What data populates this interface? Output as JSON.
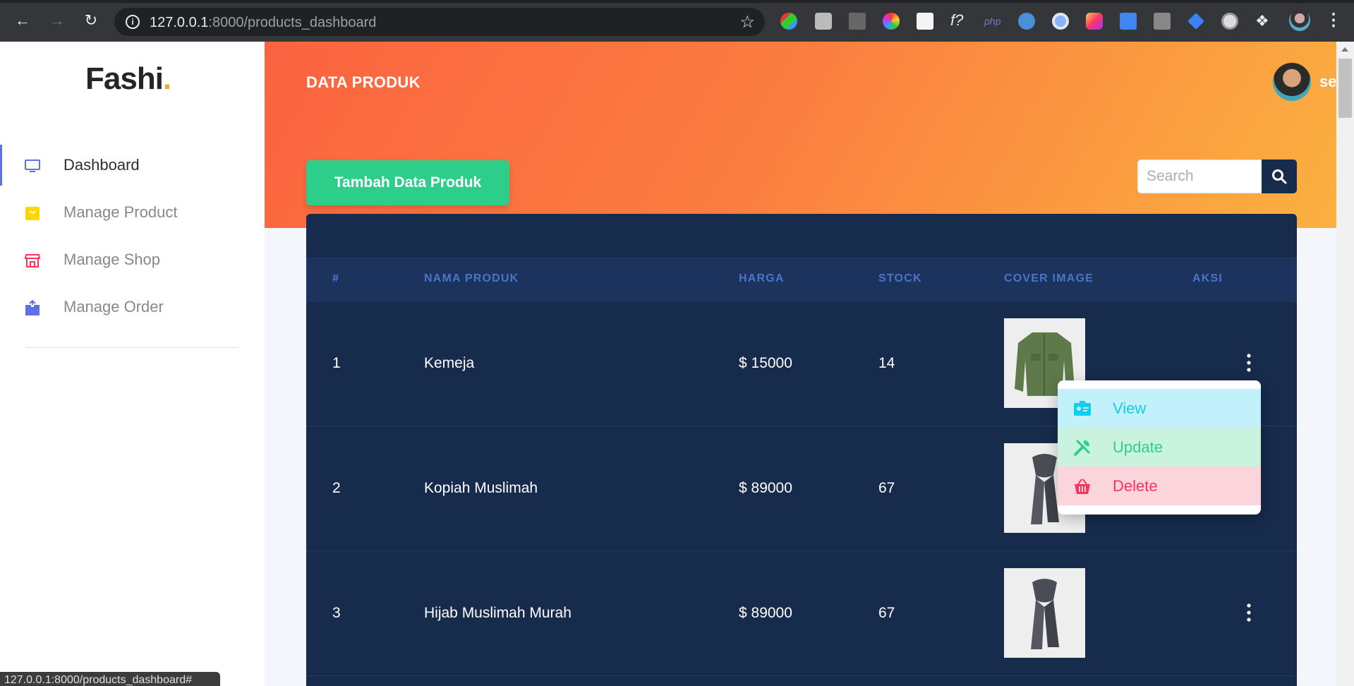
{
  "browser": {
    "url_host": "127.0.0.1",
    "url_path": ":8000/products_dashboard",
    "status_url": "127.0.0.1:8000/products_dashboard#"
  },
  "brand": {
    "name": "Fashi",
    "dot": "."
  },
  "sidebar": {
    "items": [
      {
        "label": "Dashboard",
        "icon": "monitor-icon",
        "color": "#5e72e4",
        "active": true
      },
      {
        "label": "Manage Product",
        "icon": "shopping-bag-icon",
        "color": "#ffd600",
        "active": false
      },
      {
        "label": "Manage Shop",
        "icon": "shop-icon",
        "color": "#f5365c",
        "active": false
      },
      {
        "label": "Manage Order",
        "icon": "box-icon",
        "color": "#5e72e4",
        "active": false
      }
    ]
  },
  "header": {
    "title": "DATA PRODUK",
    "username": "seller"
  },
  "actions": {
    "add_label": "Tambah Data Produk",
    "search_placeholder": "Search"
  },
  "table": {
    "columns": [
      "#",
      "NAMA PRODUK",
      "HARGA",
      "STOCK",
      "COVER IMAGE",
      "AKSI"
    ],
    "rows": [
      {
        "no": "1",
        "name": "Kemeja",
        "price": "$ 15000",
        "stock": "14",
        "cover": "jacket-image"
      },
      {
        "no": "2",
        "name": "Kopiah Muslimah",
        "price": "$ 89000",
        "stock": "67",
        "cover": "scarf-image"
      },
      {
        "no": "3",
        "name": "Hijab Muslimah Murah",
        "price": "$ 89000",
        "stock": "67",
        "cover": "scarf-image"
      }
    ]
  },
  "dropdown": {
    "items": [
      {
        "label": "View",
        "icon": "id-card-icon",
        "color": "#11cdef",
        "bg": "#c3f1fb"
      },
      {
        "label": "Update",
        "icon": "tools-icon",
        "color": "#2dce89",
        "bg": "#c9f2df"
      },
      {
        "label": "Delete",
        "icon": "basket-icon",
        "color": "#f5365c",
        "bg": "#fcd4dc"
      }
    ]
  },
  "colors": {
    "accent": "#5e72e4",
    "success": "#2dce89",
    "table_bg": "#172b4d",
    "header_start": "#fb6340",
    "header_end": "#fbb140"
  }
}
